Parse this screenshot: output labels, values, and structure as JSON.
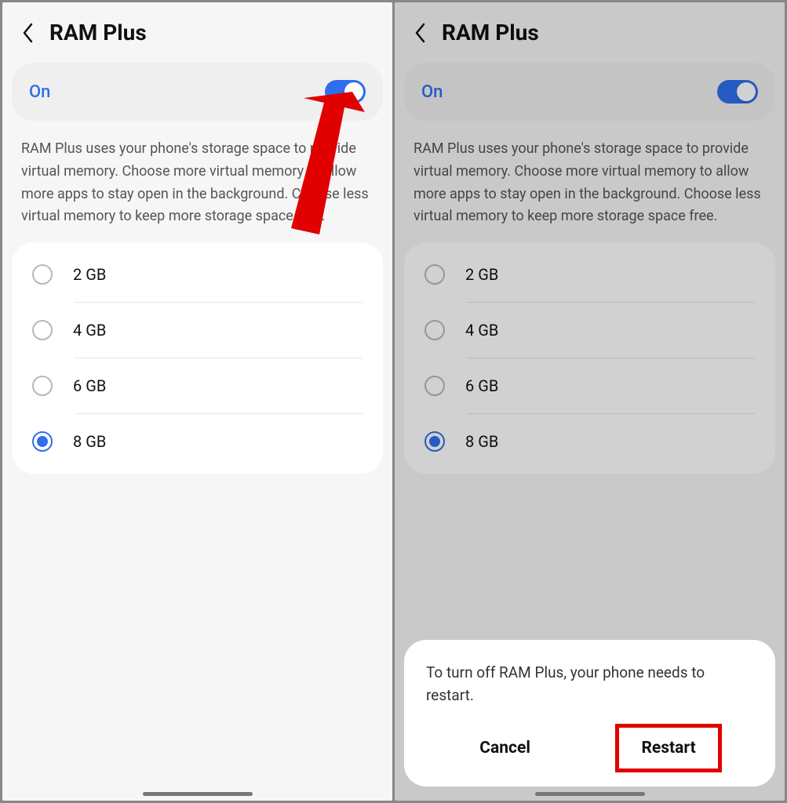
{
  "left": {
    "header": {
      "title": "RAM Plus"
    },
    "toggle": {
      "label": "On",
      "state": true
    },
    "description": "RAM Plus uses your phone's storage space to provide virtual memory. Choose more virtual memory to allow more apps to stay open in the background. Choose less virtual memory to keep more storage space free.",
    "options": [
      {
        "label": "2 GB",
        "selected": false
      },
      {
        "label": "4 GB",
        "selected": false
      },
      {
        "label": "6 GB",
        "selected": false
      },
      {
        "label": "8 GB",
        "selected": true
      }
    ]
  },
  "right": {
    "header": {
      "title": "RAM Plus"
    },
    "toggle": {
      "label": "On",
      "state": true
    },
    "description": "RAM Plus uses your phone's storage space to provide virtual memory. Choose more virtual memory to allow more apps to stay open in the background. Choose less virtual memory to keep more storage space free.",
    "options": [
      {
        "label": "2 GB",
        "selected": false
      },
      {
        "label": "4 GB",
        "selected": false
      },
      {
        "label": "6 GB",
        "selected": false
      },
      {
        "label": "8 GB",
        "selected": true
      }
    ],
    "sheet": {
      "message": "To turn off RAM Plus, your phone needs to restart.",
      "cancel": "Cancel",
      "confirm": "Restart"
    }
  }
}
